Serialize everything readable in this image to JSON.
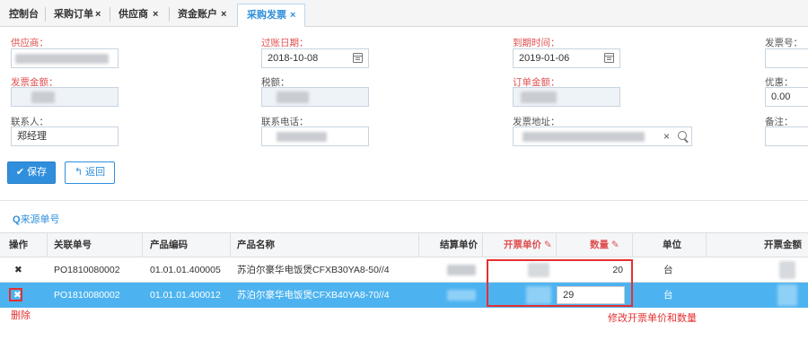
{
  "tabs": [
    {
      "label": "控制台",
      "closable": false
    },
    {
      "label": "采购订单",
      "closable": true
    },
    {
      "label": "供应商",
      "closable": true
    },
    {
      "label": "资金账户",
      "closable": true
    },
    {
      "label": "采购发票",
      "closable": true,
      "active": true
    }
  ],
  "close_glyph": "×",
  "form": {
    "supplier_label": "供应商：",
    "post_date_label": "过账日期：",
    "post_date_value": "2018-10-08",
    "due_date_label": "到期时间：",
    "due_date_value": "2019-01-06",
    "invoice_no_label": "发票号：",
    "invoice_amount_label": "发票金额：",
    "tax_label": "税额：",
    "order_amount_label": "订单金额：",
    "discount_label": "优惠：",
    "discount_value": "0.00",
    "contact_label": "联系人：",
    "contact_value": "郑经理",
    "phone_label": "联系电话：",
    "address_label": "发票地址：",
    "address_clear": "×",
    "remark_label": "备注："
  },
  "buttons": {
    "save_label": "保存",
    "back_label": "返回"
  },
  "source_link": "来源单号",
  "table": {
    "headers": [
      "操作",
      "关联单号",
      "产品编码",
      "产品名称",
      "结算单价",
      "开票单价",
      "数量",
      "单位",
      "开票金额"
    ],
    "rows": [
      {
        "action": "✖",
        "order_no": "PO1810080002",
        "code": "01.01.01.400005",
        "name": "苏泊尔豪华电饭煲CFXB30YA8-50//4",
        "qty": "20",
        "unit": "台"
      },
      {
        "action": "✖",
        "order_no": "PO1810080002",
        "code": "01.01.01.400012",
        "name": "苏泊尔豪华电饭煲CFXB40YA8-70//4",
        "qty": "29",
        "unit": "台"
      }
    ]
  },
  "annotations": {
    "delete_label": "删除",
    "edit_label": "修改开票单价和数量"
  },
  "colors": {
    "accent": "#2f8fdc",
    "required": "#e04f4f",
    "selected_row": "#4db3f0",
    "annotation": "#e53030"
  }
}
